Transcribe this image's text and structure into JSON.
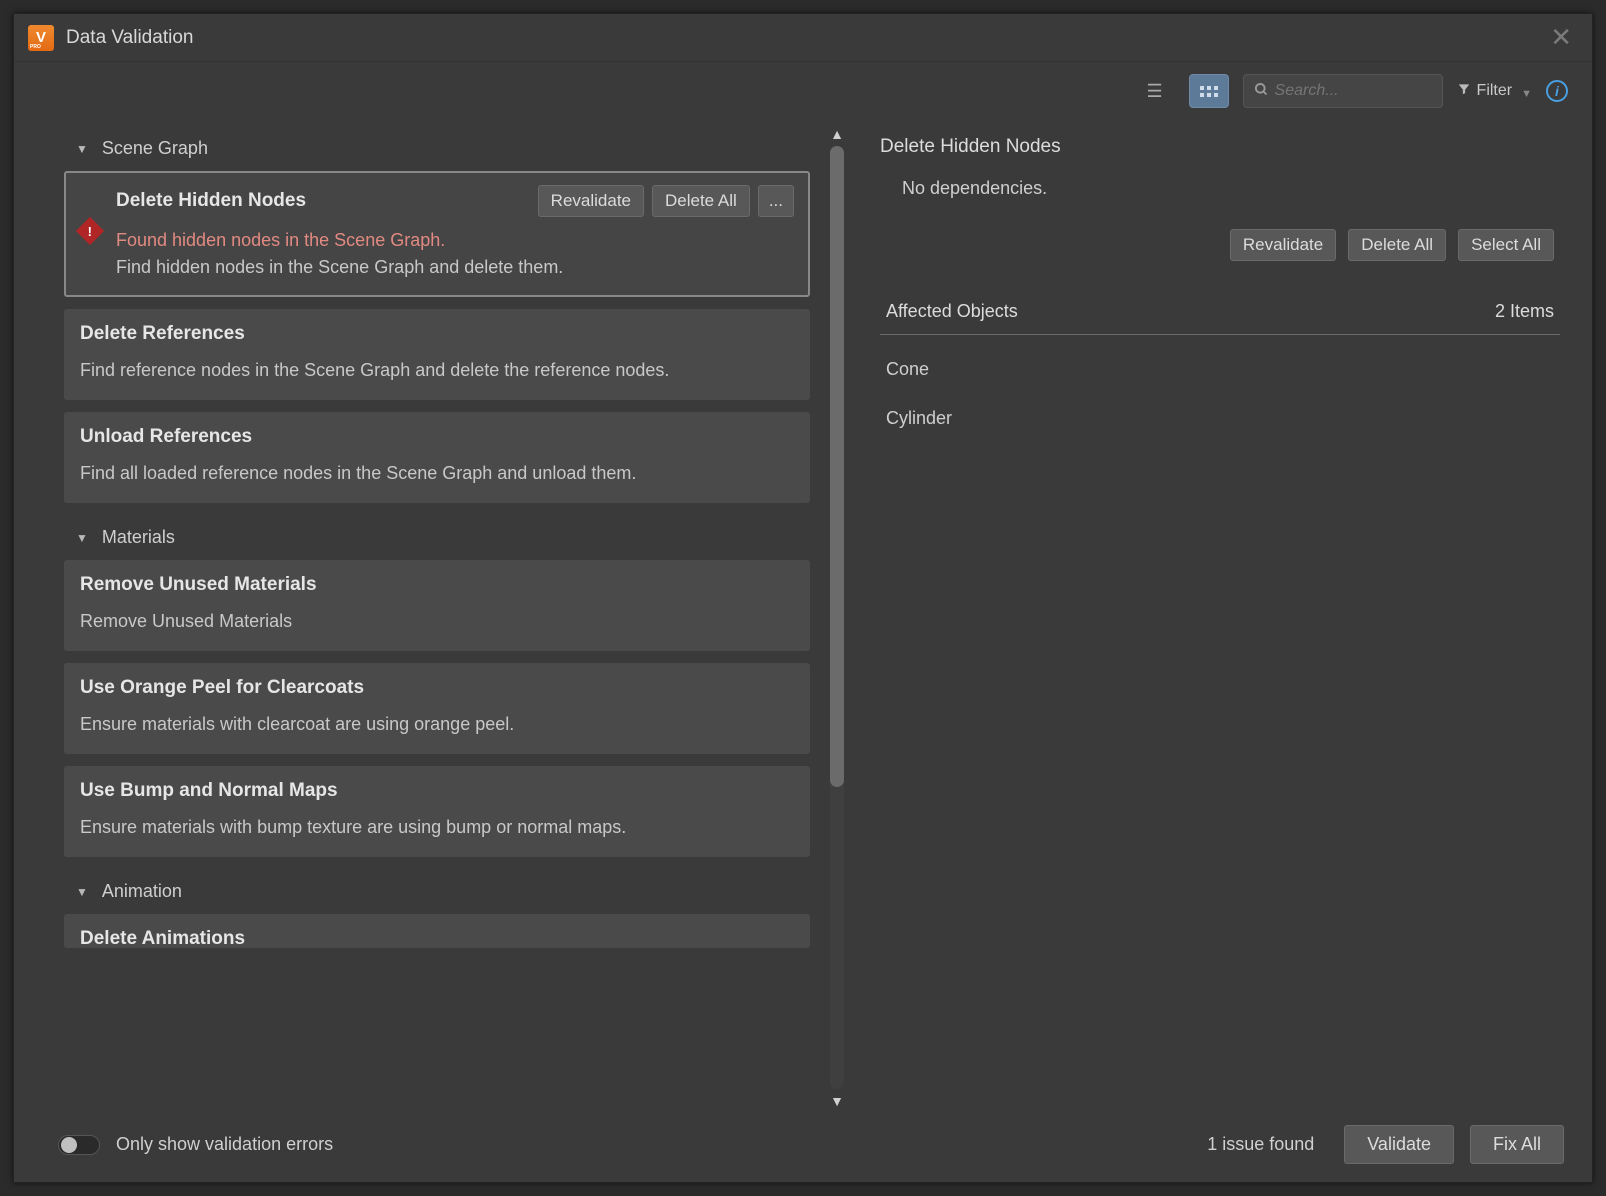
{
  "window": {
    "title": "Data Validation"
  },
  "toolbar": {
    "search_placeholder": "Search...",
    "filter_label": "Filter"
  },
  "sections": [
    {
      "name": "Scene Graph",
      "items": [
        {
          "title": "Delete Hidden Nodes",
          "error": "Found hidden nodes in the Scene Graph.",
          "desc": "Find hidden nodes in the Scene Graph and delete them.",
          "selected": true,
          "actions": {
            "revalidate": "Revalidate",
            "delete_all": "Delete All",
            "more": "..."
          }
        },
        {
          "title": "Delete References",
          "desc": "Find reference nodes in the Scene Graph and delete the reference nodes."
        },
        {
          "title": "Unload References",
          "desc": "Find all loaded reference nodes in the Scene Graph and unload them."
        }
      ]
    },
    {
      "name": "Materials",
      "items": [
        {
          "title": "Remove Unused Materials",
          "desc": "Remove Unused Materials"
        },
        {
          "title": "Use Orange Peel for Clearcoats",
          "desc": "Ensure materials with clearcoat are using orange peel."
        },
        {
          "title": "Use Bump and Normal Maps",
          "desc": "Ensure materials with bump texture are using bump or normal maps."
        }
      ]
    },
    {
      "name": "Animation",
      "items": [
        {
          "title": "Delete Animations",
          "desc": ""
        }
      ]
    }
  ],
  "detail": {
    "title": "Delete Hidden Nodes",
    "sub": "No dependencies.",
    "buttons": {
      "revalidate": "Revalidate",
      "delete_all": "Delete All",
      "select_all": "Select All"
    },
    "affected_label": "Affected Objects",
    "count_label": "2 Items",
    "objects": [
      "Cone",
      "Cylinder"
    ]
  },
  "footer": {
    "toggle_label": "Only show validation errors",
    "issue_text": "1 issue found",
    "validate": "Validate",
    "fix_all": "Fix All"
  }
}
